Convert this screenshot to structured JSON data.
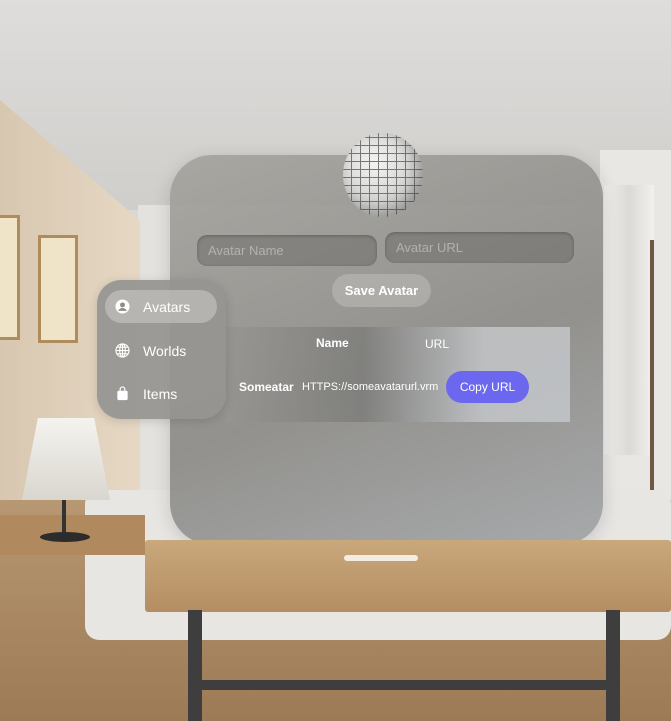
{
  "form": {
    "name_placeholder": "Avatar Name",
    "url_placeholder": "Avatar URL",
    "save_label": "Save Avatar"
  },
  "table": {
    "headers": {
      "name": "Name",
      "url": "URL"
    },
    "rows": [
      {
        "name": "Someatar",
        "url": "HTTPS://someavatarurl.vrm",
        "action": "Copy URL"
      }
    ]
  },
  "sidebar": {
    "items": [
      {
        "label": "Avatars",
        "icon": "person-circle-icon",
        "active": true
      },
      {
        "label": "Worlds",
        "icon": "globe-icon",
        "active": false
      },
      {
        "label": "Items",
        "icon": "bag-icon",
        "active": false
      }
    ]
  },
  "colors": {
    "accent": "#6b67ef"
  }
}
